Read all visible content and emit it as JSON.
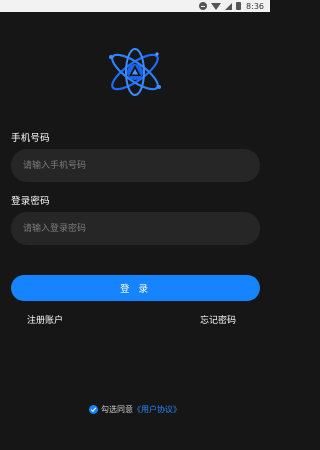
{
  "status_bar": {
    "time": "8:36"
  },
  "phone": {
    "label": "手机号码",
    "placeholder": "请输入手机号码",
    "value": ""
  },
  "password": {
    "label": "登录密码",
    "placeholder": "请输入登录密码",
    "value": ""
  },
  "login_button": "登 录",
  "links": {
    "register": "注册账户",
    "forgot": "忘记密码"
  },
  "agreement": {
    "text": "勾选同意",
    "link": "《用户协议》",
    "checked": true
  },
  "colors": {
    "accent": "#1683ff",
    "background": "#161616",
    "input_bg": "#262626"
  }
}
